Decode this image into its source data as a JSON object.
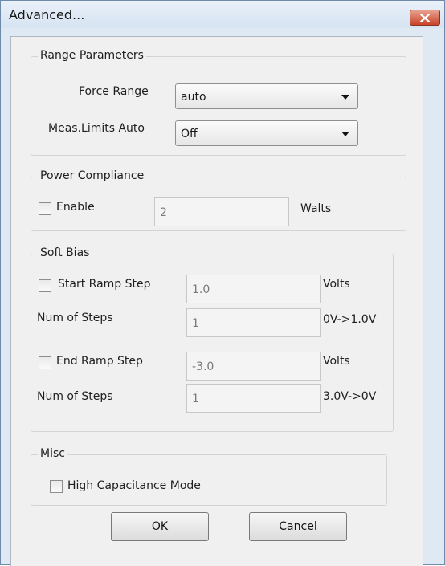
{
  "window": {
    "title": "Advanced..."
  },
  "range": {
    "title": "Range Parameters",
    "force_label": "Force Range",
    "force_value": "auto",
    "meas_label": "Meas.Limits Auto",
    "meas_value": "Off"
  },
  "power": {
    "title": "Power Compliance",
    "enable_label": "Enable",
    "enable_checked": false,
    "value": "2",
    "unit": "Walts"
  },
  "softbias": {
    "title": "Soft Bias",
    "start_label": "Start Ramp Step",
    "start_checked": false,
    "start_value": "1.0",
    "start_unit": "Volts",
    "steps1_label": "Num of Steps",
    "steps1_value": "1",
    "steps1_range": "0V->1.0V",
    "end_label": "End Ramp Step",
    "end_checked": false,
    "end_value": "-3.0",
    "end_unit": "Volts",
    "steps2_label": "Num of Steps",
    "steps2_value": "1",
    "steps2_range": "3.0V->0V"
  },
  "misc": {
    "title": "Misc",
    "highcap_label": "High Capacitance Mode",
    "highcap_checked": false
  },
  "buttons": {
    "ok": "OK",
    "cancel": "Cancel"
  }
}
